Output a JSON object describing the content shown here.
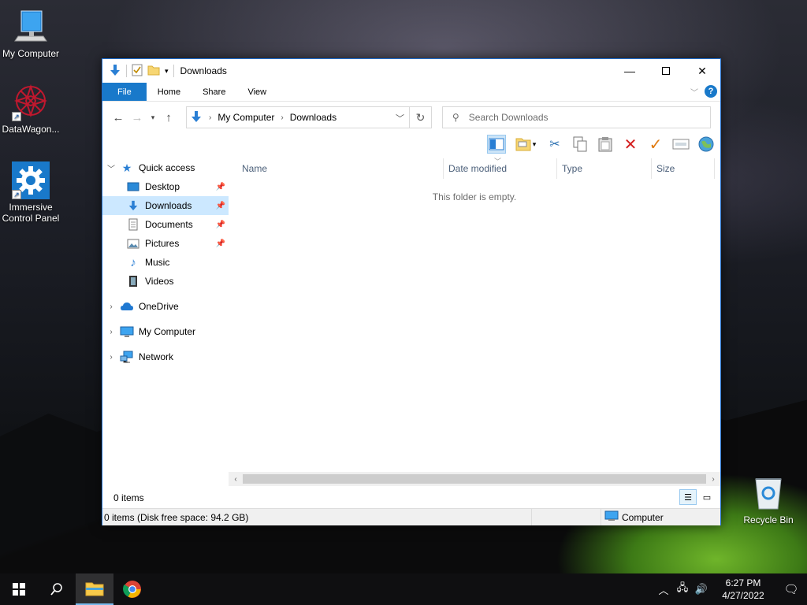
{
  "desktop": {
    "icons": [
      {
        "label": "My Computer",
        "icon": "monitor-icon"
      },
      {
        "label": "DataWagon...",
        "icon": "datawagon-icon"
      },
      {
        "label": "Immersive Control Panel",
        "icon": "gear-icon"
      },
      {
        "label": "Recycle Bin",
        "icon": "recycle-bin-icon"
      }
    ]
  },
  "window": {
    "title": "Downloads",
    "ribbon_tabs": [
      "File",
      "Home",
      "Share",
      "View"
    ],
    "address": {
      "path": [
        "My Computer",
        "Downloads"
      ]
    },
    "search": {
      "placeholder": "Search Downloads"
    },
    "toolbar_icons": [
      "preview-pane-icon",
      "new-folder-icon",
      "cut-icon",
      "copy-icon",
      "paste-icon",
      "delete-icon",
      "check-icon",
      "rename-icon",
      "globe-icon"
    ],
    "nav": {
      "quick_access": "Quick access",
      "quick_items": [
        {
          "label": "Desktop",
          "icon": "desktop-icon",
          "pinned": true
        },
        {
          "label": "Downloads",
          "icon": "downloads-icon",
          "pinned": true,
          "selected": true
        },
        {
          "label": "Documents",
          "icon": "documents-icon",
          "pinned": true
        },
        {
          "label": "Pictures",
          "icon": "pictures-icon",
          "pinned": true
        },
        {
          "label": "Music",
          "icon": "music-icon"
        },
        {
          "label": "Videos",
          "icon": "videos-icon"
        }
      ],
      "roots": [
        {
          "label": "OneDrive",
          "icon": "onedrive-icon"
        },
        {
          "label": "My Computer",
          "icon": "computer-icon"
        },
        {
          "label": "Network",
          "icon": "network-icon"
        }
      ]
    },
    "columns": [
      "Name",
      "Date modified",
      "Type",
      "Size"
    ],
    "empty_message": "This folder is empty.",
    "status": {
      "items": "0 items"
    },
    "details_bar": {
      "left": "0 items (Disk free space: 94.2 GB)",
      "right": "Computer"
    }
  },
  "taskbar": {
    "time": "6:27 PM",
    "date": "4/27/2022"
  },
  "colors": {
    "accent": "#1979ca",
    "selection": "#cce8ff"
  }
}
